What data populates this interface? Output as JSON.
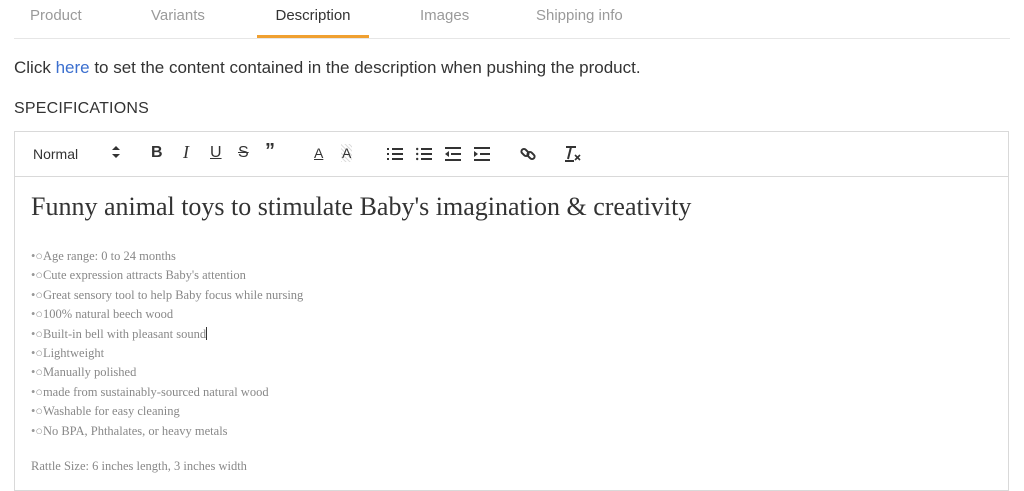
{
  "tabs": [
    {
      "label": "Product",
      "active": false
    },
    {
      "label": "Variants",
      "active": false
    },
    {
      "label": "Description",
      "active": true
    },
    {
      "label": "Images",
      "active": false
    },
    {
      "label": "Shipping info",
      "active": false
    }
  ],
  "instruction": {
    "prefix": "Click ",
    "link": "here",
    "suffix": " to set the content contained in the description when pushing the product."
  },
  "section_title": "SPECIFICATIONS",
  "toolbar": {
    "format": "Normal",
    "bold": "B",
    "italic": "I",
    "underline": "U",
    "strike": "S",
    "quote": "”",
    "font_color": "A",
    "highlight": "A",
    "icons": [
      "ordered-list-icon",
      "bullet-list-icon",
      "outdent-icon",
      "indent-icon",
      "link-icon",
      "clear-format-icon"
    ]
  },
  "content": {
    "heading": "Funny animal toys to stimulate Baby's imagination & creativity",
    "bullet_marker": "•○",
    "items": [
      "Age range: 0 to 24 months",
      "Cute expression attracts Baby's attention",
      "Great sensory tool to help Baby focus while nursing",
      "100% natural beech wood",
      "Built-in bell with pleasant sound",
      "Lightweight",
      "Manually polished",
      "made from sustainably-sourced natural wood",
      "Washable for easy cleaning",
      "No BPA, Phthalates, or heavy metals"
    ],
    "size_line": "Rattle Size: 6 inches length, 3 inches width"
  },
  "colors": {
    "accent": "#f0a030",
    "link": "#3b6fcf"
  }
}
